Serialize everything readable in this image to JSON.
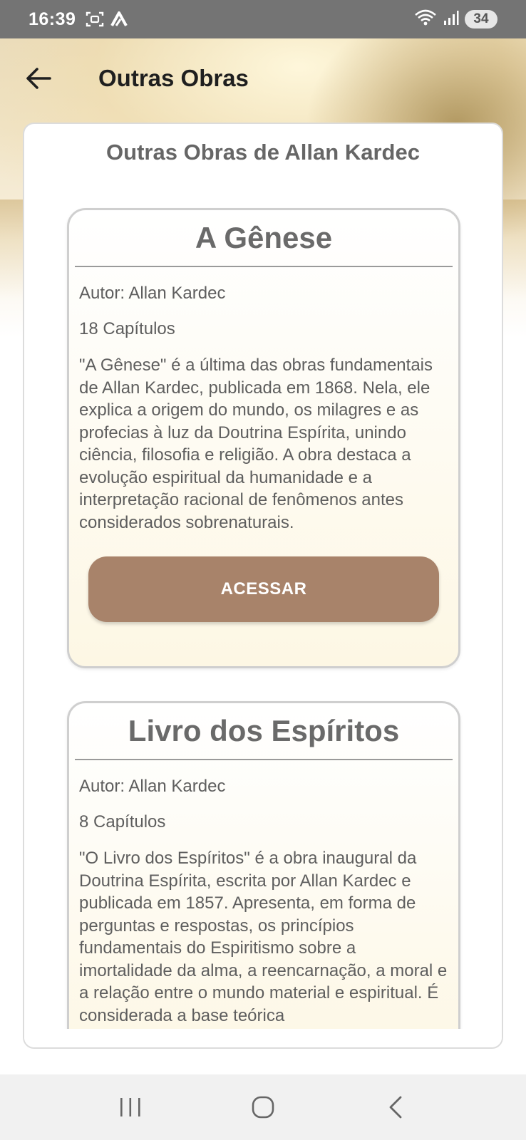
{
  "status_bar": {
    "time": "16:39",
    "battery": "34",
    "icons_left": [
      "screenshot-icon",
      "app-logo-icon"
    ],
    "icons_right": [
      "wifi-icon",
      "signal-icon"
    ]
  },
  "app_bar": {
    "title": "Outras Obras",
    "back_icon": "arrow-left-icon"
  },
  "main": {
    "section_title": "Outras Obras de Allan Kardec",
    "books": [
      {
        "title": "A Gênese",
        "author": "Autor: Allan Kardec",
        "chapters": "18 Capítulos",
        "description": "\"A Gênese\" é a última das obras fundamentais de Allan Kardec, publicada em 1868. Nela, ele explica a origem do mundo, os milagres e as profecias à luz da Doutrina Espírita, unindo ciência, filosofia e religião. A obra destaca a evolução espiritual da humanidade e a interpretação racional de fenômenos antes considerados sobrenaturais.",
        "button_label": "ACESSAR"
      },
      {
        "title": "Livro dos Espíritos",
        "author": "Autor: Allan Kardec",
        "chapters": "8 Capítulos",
        "description": "\"O Livro dos Espíritos\" é a obra inaugural da Doutrina Espírita, escrita por Allan Kardec e publicada em 1857. Apresenta, em forma de perguntas e respostas, os princípios fundamentais do Espiritismo sobre a imortalidade da alma, a reencarnação, a moral e a relação entre o mundo material e espiritual. É considerada a base teórica"
      }
    ]
  },
  "nav_bar": {
    "items": [
      "recents-icon",
      "home-icon",
      "back-icon"
    ]
  },
  "colors": {
    "status_bar": "#747474",
    "button": "#a8836a",
    "card_border": "#cfcfcf",
    "nav_bar": "#f1f1f1"
  }
}
